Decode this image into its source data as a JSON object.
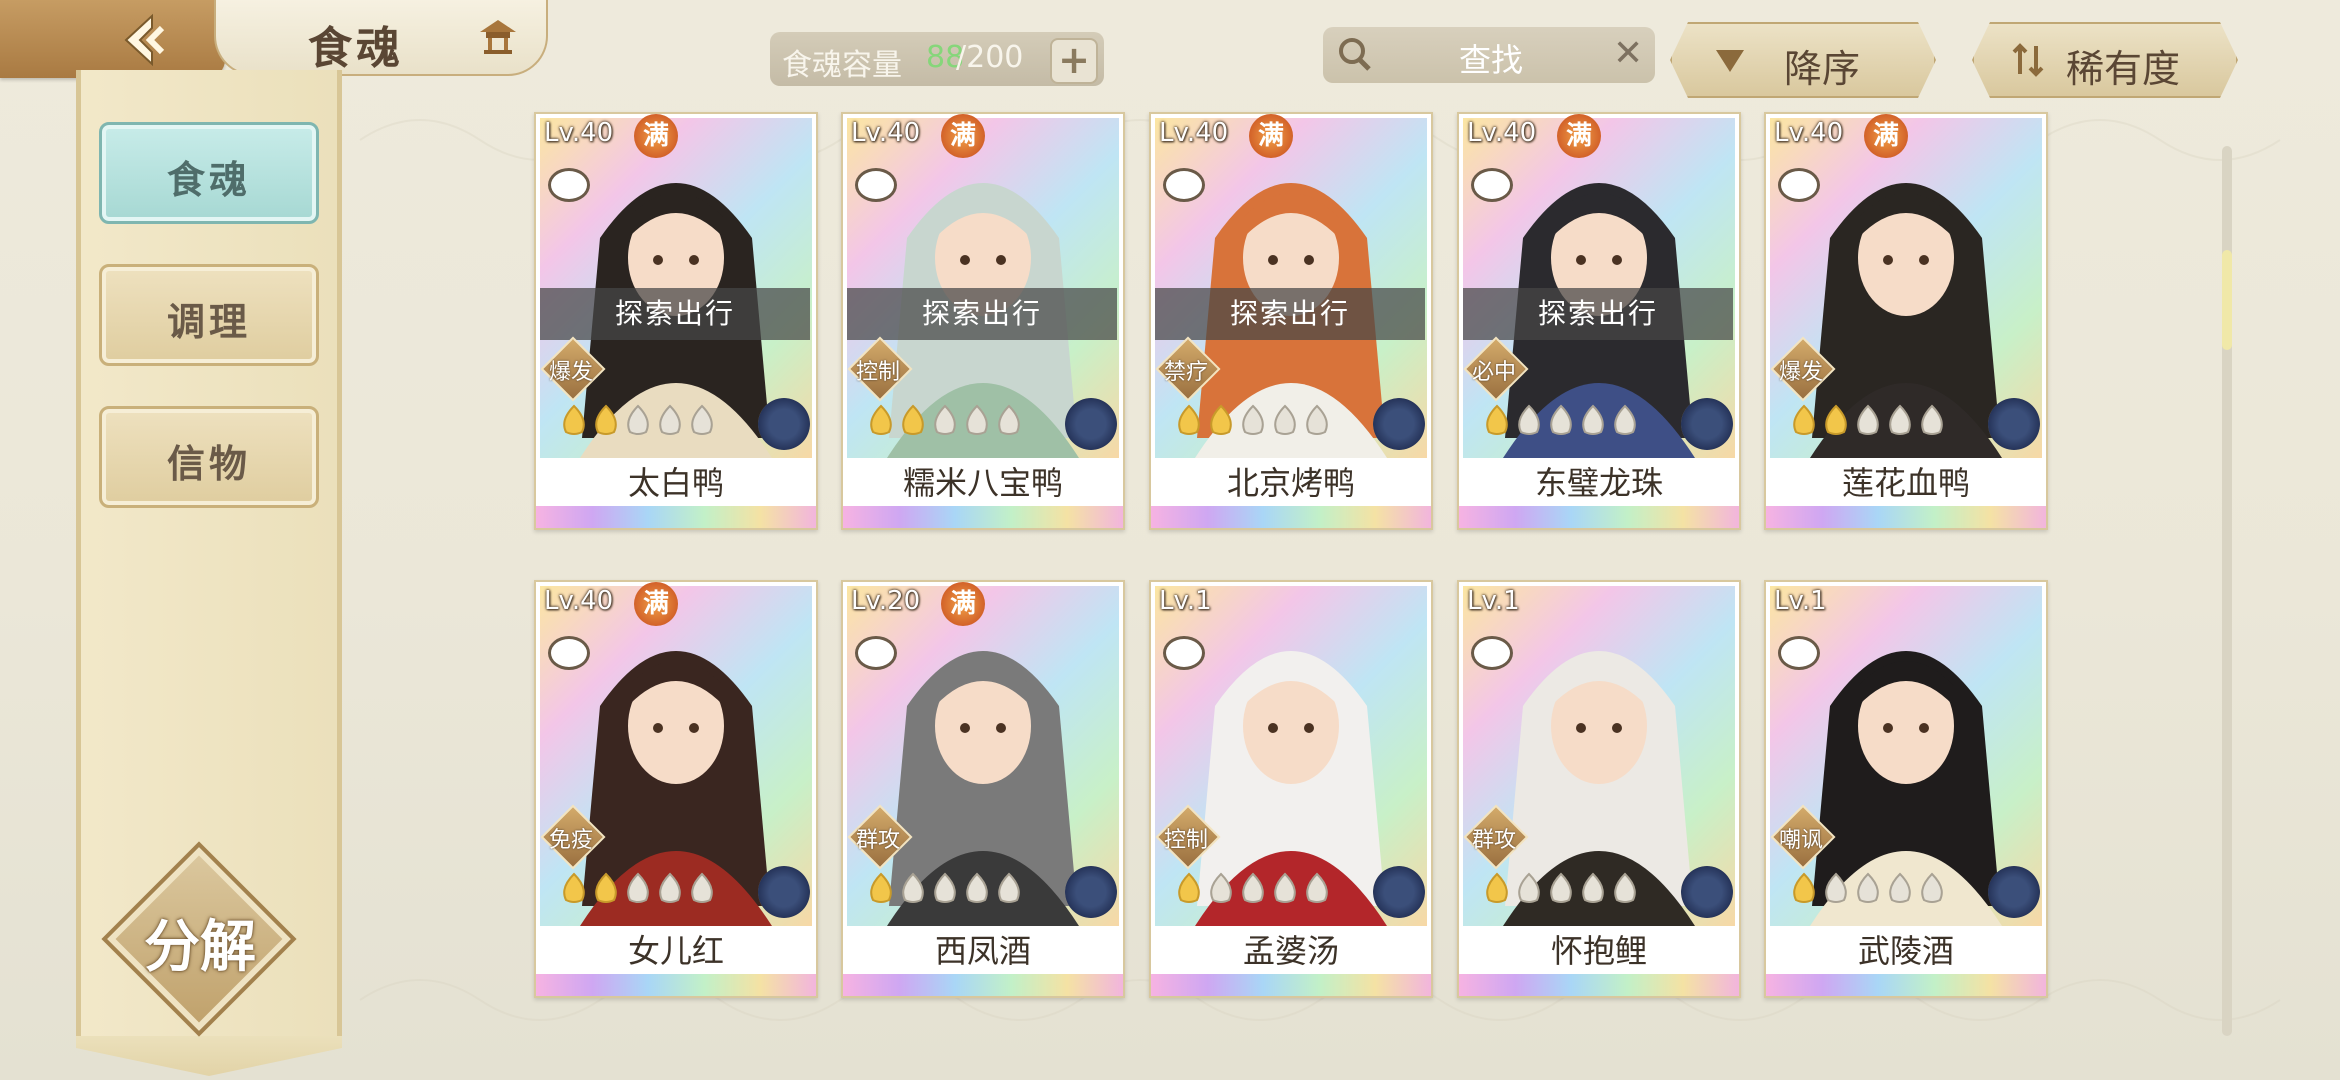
{
  "header": {
    "title": "食魂",
    "capacity_label": "食魂容量",
    "capacity_current": "88",
    "capacity_max": "/200",
    "capacity_add": "+",
    "search_placeholder": "查找",
    "search_clear": "✕",
    "sort_order": "降序",
    "sort_by": "稀有度"
  },
  "sidebar": {
    "items": [
      {
        "label": "食魂",
        "active": true
      },
      {
        "label": "调理",
        "active": false
      },
      {
        "label": "信物",
        "active": false
      }
    ],
    "decompose_label": "分解"
  },
  "cards": [
    {
      "level": "Lv.40",
      "max": "满",
      "explore": "探索出行",
      "role": "爆发",
      "name": "太白鸭",
      "stars_lit": 2,
      "hair": "#2a2420",
      "outfit": "#e9dcc0"
    },
    {
      "level": "Lv.40",
      "max": "满",
      "explore": "探索出行",
      "role": "控制",
      "name": "糯米八宝鸭",
      "stars_lit": 2,
      "hair": "#c8d6cf",
      "outfit": "#9fc0a6"
    },
    {
      "level": "Lv.40",
      "max": "满",
      "explore": "探索出行",
      "role": "禁疗",
      "name": "北京烤鸭",
      "stars_lit": 2,
      "hair": "#d8733a",
      "outfit": "#f1efe8"
    },
    {
      "level": "Lv.40",
      "max": "满",
      "explore": "探索出行",
      "role": "必中",
      "name": "东璧龙珠",
      "stars_lit": 1,
      "hair": "#2b2a2e",
      "outfit": "#3e4f86"
    },
    {
      "level": "Lv.40",
      "max": "满",
      "explore": "",
      "role": "爆发",
      "name": "莲花血鸭",
      "stars_lit": 2,
      "hair": "#2a2622",
      "outfit": "#2f2a28"
    },
    {
      "level": "Lv.40",
      "max": "满",
      "explore": "",
      "role": "免疫",
      "name": "女儿红",
      "stars_lit": 2,
      "hair": "#3a2620",
      "outfit": "#9c2b22"
    },
    {
      "level": "Lv.20",
      "max": "满",
      "explore": "",
      "role": "群攻",
      "name": "西凤酒",
      "stars_lit": 1,
      "hair": "#7a7a7a",
      "outfit": "#3a3a3a"
    },
    {
      "level": "Lv.1",
      "max": "",
      "explore": "",
      "role": "控制",
      "name": "孟婆汤",
      "stars_lit": 1,
      "hair": "#f2f0ee",
      "outfit": "#b3262a"
    },
    {
      "level": "Lv.1",
      "max": "",
      "explore": "",
      "role": "群攻",
      "name": "怀抱鲤",
      "stars_lit": 1,
      "hair": "#ece9e4",
      "outfit": "#2f2a24"
    },
    {
      "level": "Lv.1",
      "max": "",
      "explore": "",
      "role": "嘲讽",
      "name": "武陵酒",
      "stars_lit": 1,
      "hair": "#1f1c1c",
      "outfit": "#f0e7cf"
    }
  ],
  "colors": {
    "accent_gold": "#c69c63",
    "active_tab": "#a6d8d3",
    "capacity_green": "#86d67a"
  }
}
